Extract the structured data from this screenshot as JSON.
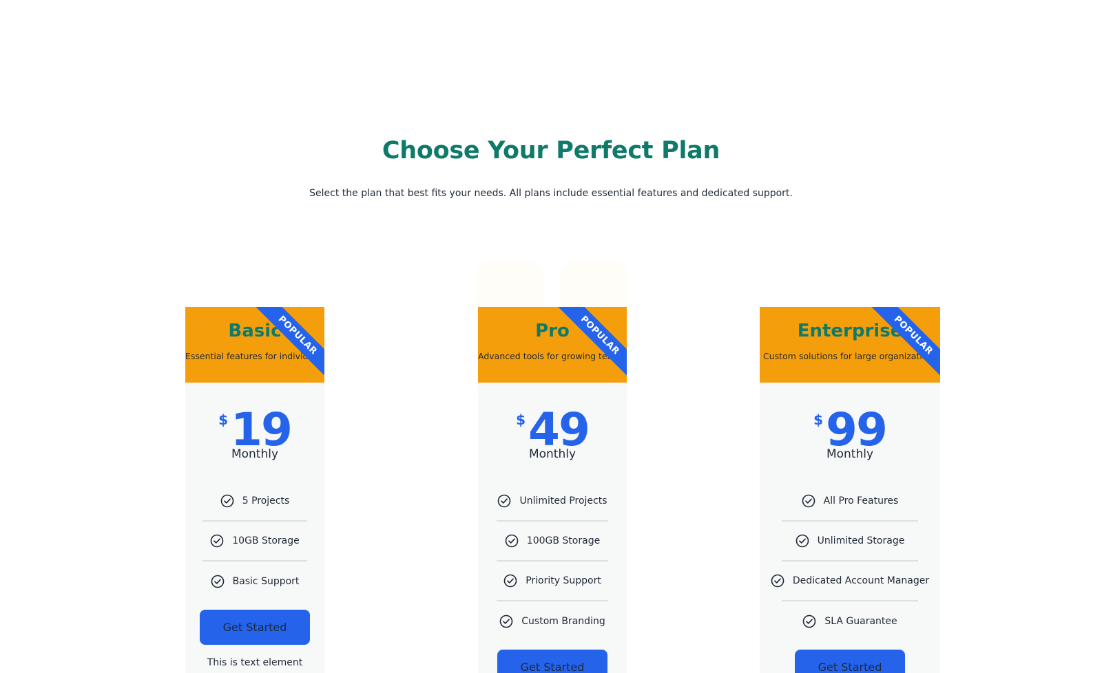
{
  "hero": {
    "title": "Choose Your Perfect Plan",
    "subtitle": "Select the plan that best fits your needs. All plans include essential features and dedicated support."
  },
  "colors": {
    "title": "#0f7a6a",
    "header_bg": "#f59e0b",
    "accent": "#2563eb",
    "card_bg": "#f7f8f8"
  },
  "plans": [
    {
      "name": "Basic",
      "description": "Essential features for individuals",
      "ribbon": "POPULAR",
      "currency": "$",
      "price": "19",
      "period": "Monthly",
      "features": [
        "5 Projects",
        "10GB Storage",
        "Basic Support"
      ],
      "cta": "Get Started",
      "note": "This is text element"
    },
    {
      "name": "Pro",
      "description": "Advanced tools for growing teams",
      "ribbon": "POPULAR",
      "currency": "$",
      "price": "49",
      "period": "Monthly",
      "features": [
        "Unlimited Projects",
        "100GB Storage",
        "Priority Support",
        "Custom Branding"
      ],
      "cta": "Get Started"
    },
    {
      "name": "Enterprise",
      "description": "Custom solutions for large organizations",
      "ribbon": "POPULAR",
      "currency": "$",
      "price": "99",
      "period": "Monthly",
      "features": [
        "All Pro Features",
        "Unlimited Storage",
        "Dedicated Account Manager",
        "SLA Guarantee"
      ],
      "cta": "Get Started"
    }
  ],
  "icons": {
    "feature": "check-circle-icon"
  }
}
